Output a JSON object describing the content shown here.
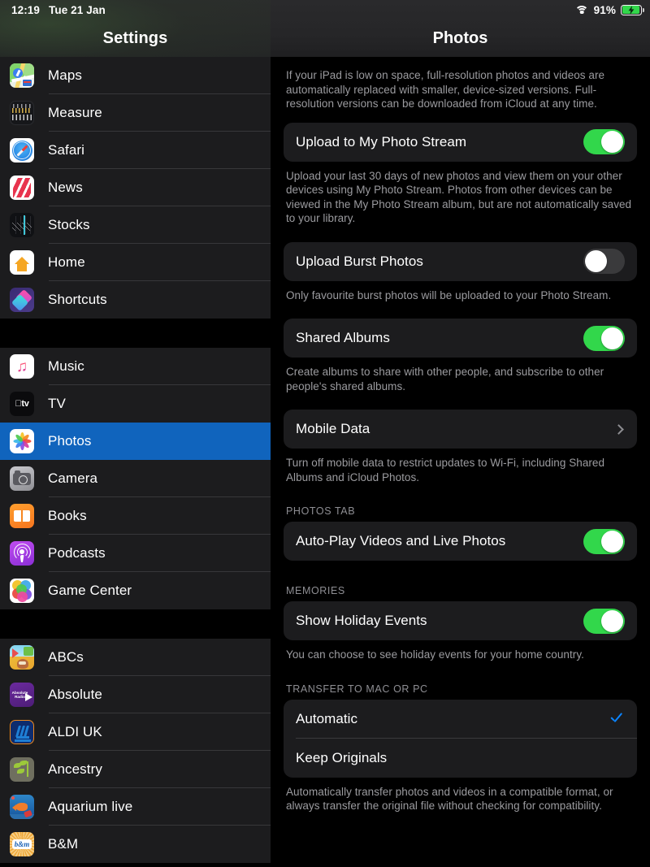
{
  "status_bar": {
    "time": "12:19",
    "date": "Tue 21 Jan",
    "wifi_icon": "wifi-icon",
    "battery_percent": "91%",
    "battery_icon": "battery-charging-icon"
  },
  "sidebar": {
    "title": "Settings",
    "groups": [
      {
        "items": [
          {
            "label": "Maps",
            "icon": "maps-app-icon"
          },
          {
            "label": "Measure",
            "icon": "measure-app-icon"
          },
          {
            "label": "Safari",
            "icon": "safari-app-icon"
          },
          {
            "label": "News",
            "icon": "news-app-icon"
          },
          {
            "label": "Stocks",
            "icon": "stocks-app-icon"
          },
          {
            "label": "Home",
            "icon": "home-app-icon"
          },
          {
            "label": "Shortcuts",
            "icon": "shortcuts-app-icon"
          }
        ]
      },
      {
        "items": [
          {
            "label": "Music",
            "icon": "music-app-icon"
          },
          {
            "label": "TV",
            "icon": "tv-app-icon"
          },
          {
            "label": "Photos",
            "icon": "photos-app-icon",
            "selected": true
          },
          {
            "label": "Camera",
            "icon": "camera-app-icon"
          },
          {
            "label": "Books",
            "icon": "books-app-icon"
          },
          {
            "label": "Podcasts",
            "icon": "podcasts-app-icon"
          },
          {
            "label": "Game Center",
            "icon": "game-center-app-icon"
          }
        ]
      },
      {
        "items": [
          {
            "label": "ABCs",
            "icon": "abcs-app-icon"
          },
          {
            "label": "Absolute",
            "icon": "absolute-radio-app-icon"
          },
          {
            "label": "ALDI UK",
            "icon": "aldi-uk-app-icon"
          },
          {
            "label": "Ancestry",
            "icon": "ancestry-app-icon"
          },
          {
            "label": "Aquarium live",
            "icon": "aquarium-live-app-icon"
          },
          {
            "label": "B&M",
            "icon": "bm-app-icon"
          }
        ]
      }
    ]
  },
  "detail": {
    "title": "Photos",
    "intro_footnote": "If your iPad is low on space, full-resolution photos and videos are automatically replaced with smaller, device-sized versions. Full-resolution versions can be downloaded from iCloud at any time.",
    "photo_stream": {
      "label": "Upload to My Photo Stream",
      "state": "on",
      "footnote": "Upload your last 30 days of new photos and view them on your other devices using My Photo Stream. Photos from other devices can be viewed in the My Photo Stream album, but are not automatically saved to your library."
    },
    "burst": {
      "label": "Upload Burst Photos",
      "state": "off",
      "footnote": "Only favourite burst photos will be uploaded to your Photo Stream."
    },
    "shared_albums": {
      "label": "Shared Albums",
      "state": "on",
      "footnote": "Create albums to share with other people, and subscribe to other people's shared albums."
    },
    "mobile_data": {
      "label": "Mobile Data",
      "accessory_icon": "chevron-right-icon",
      "footnote": "Turn off mobile data to restrict updates to Wi-Fi, including Shared Albums and iCloud Photos."
    },
    "photos_tab": {
      "header": "PHOTOS TAB",
      "autoplay": {
        "label": "Auto-Play Videos and Live Photos",
        "state": "on"
      }
    },
    "memories": {
      "header": "MEMORIES",
      "holiday": {
        "label": "Show Holiday Events",
        "state": "on"
      },
      "footnote": "You can choose to see holiday events for your home country."
    },
    "transfer": {
      "header": "TRANSFER TO MAC OR PC",
      "options": [
        {
          "label": "Automatic",
          "selected": true,
          "check_icon": "checkmark-icon"
        },
        {
          "label": "Keep Originals",
          "selected": false
        }
      ],
      "footnote": "Automatically transfer photos and videos in a compatible format, or always transfer the original file without checking for compatibility."
    }
  },
  "colors": {
    "selection_blue": "#1064bd",
    "toggle_on_green": "#32d74b",
    "toggle_off_gray": "#3a3a3c",
    "accent_blue": "#0a84ff",
    "card_bg": "#1c1c1e",
    "page_bg": "#000000"
  }
}
